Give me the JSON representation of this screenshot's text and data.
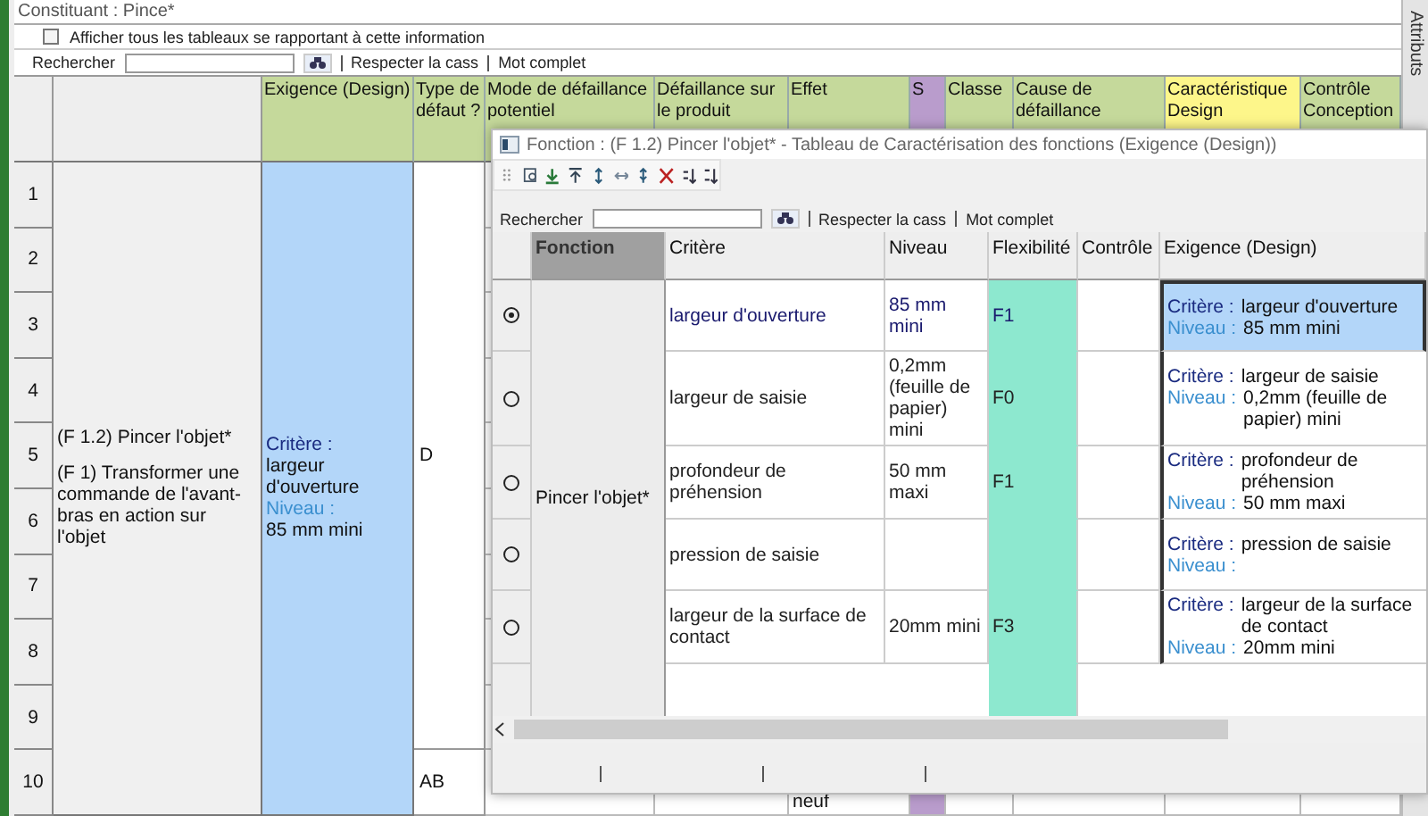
{
  "panel": {
    "title": "Constituant : Pince*",
    "show_all": {
      "label": "Afficher tous les tableaux se rapportant à cette information",
      "checked": false
    }
  },
  "search": {
    "label": "Rechercher",
    "match_case": "Respecter la cass",
    "whole_word": "Mot complet"
  },
  "side_tab": "Attributs",
  "table": {
    "columns": [
      {
        "label": "Exigence (Design)",
        "kind": "standard"
      },
      {
        "label": "Type de défaut ?",
        "kind": "standard"
      },
      {
        "label": "Mode de défaillance potentiel",
        "kind": "standard"
      },
      {
        "label": "Défaillance sur le produit",
        "kind": "standard"
      },
      {
        "label": "Effet",
        "kind": "standard"
      },
      {
        "label": "S",
        "kind": "severity"
      },
      {
        "label": "Classe",
        "kind": "standard"
      },
      {
        "label": "Cause de défaillance",
        "kind": "standard"
      },
      {
        "label": "Caractéristique Design",
        "kind": "highlight"
      },
      {
        "label": "Contrôle Conception",
        "kind": "standard"
      }
    ],
    "row_numbers": [
      "1",
      "2",
      "3",
      "4",
      "5",
      "6",
      "7",
      "8",
      "9",
      "10"
    ],
    "function_cell": [
      "(F 1.2)  Pincer l'objet*",
      "(F 1)  Transformer une commande de l'avant-bras en action sur l'objet"
    ],
    "exigence_cell": {
      "critere_label": "Critère :",
      "critere": "largeur d'ouverture",
      "niveau_label": "Niveau :",
      "niveau": "85 mm mini"
    },
    "type_cells": [
      "D",
      "AB"
    ],
    "effect_last": "neuf"
  },
  "dialog": {
    "title": "Fonction : (F 1.2) Pincer l'objet*  -  Tableau de Caractérisation des fonctions  (Exigence (Design))",
    "search": {
      "label": "Rechercher",
      "match_case": "Respecter la cass",
      "whole_word": "Mot complet"
    },
    "columns": [
      "Fonction",
      "Critère",
      "Niveau",
      "Flexibilité",
      "Contrôle",
      "Exigence (Design)"
    ],
    "function_label": "Pincer l'objet*",
    "rows": [
      {
        "selected": true,
        "critere": "largeur d'ouverture",
        "niveau": "85 mm mini",
        "flexibilite": "F1",
        "exigence": {
          "critere_label": "Critère :",
          "critere": "largeur d'ouverture",
          "niveau_label": "Niveau :",
          "niveau": "85 mm mini"
        }
      },
      {
        "selected": false,
        "critere": "largeur de saisie",
        "niveau": "0,2mm (feuille de papier) mini",
        "flexibilite": "F0",
        "exigence": {
          "critere_label": "Critère :",
          "critere": "largeur de saisie",
          "niveau_label": "Niveau :",
          "niveau": "0,2mm (feuille de papier) mini"
        }
      },
      {
        "selected": false,
        "critere": "profondeur de préhension",
        "niveau": "50 mm maxi",
        "flexibilite": "F1",
        "exigence": {
          "critere_label": "Critère :",
          "critere": "profondeur de préhension",
          "niveau_label": "Niveau :",
          "niveau": "50 mm maxi"
        }
      },
      {
        "selected": false,
        "critere": "pression de saisie",
        "flexibilite": "",
        "exigence": {
          "critere_label": "Critère :",
          "critere": "pression de saisie",
          "niveau_label": "Niveau :"
        }
      },
      {
        "selected": false,
        "critere": "largeur de la surface de contact",
        "niveau": "20mm mini",
        "flexibilite": "F3",
        "exigence": {
          "critere_label": "Critère :",
          "critere": "largeur de la surface de contact",
          "niveau_label": "Niveau :",
          "niveau": "20mm mini"
        }
      }
    ]
  }
}
